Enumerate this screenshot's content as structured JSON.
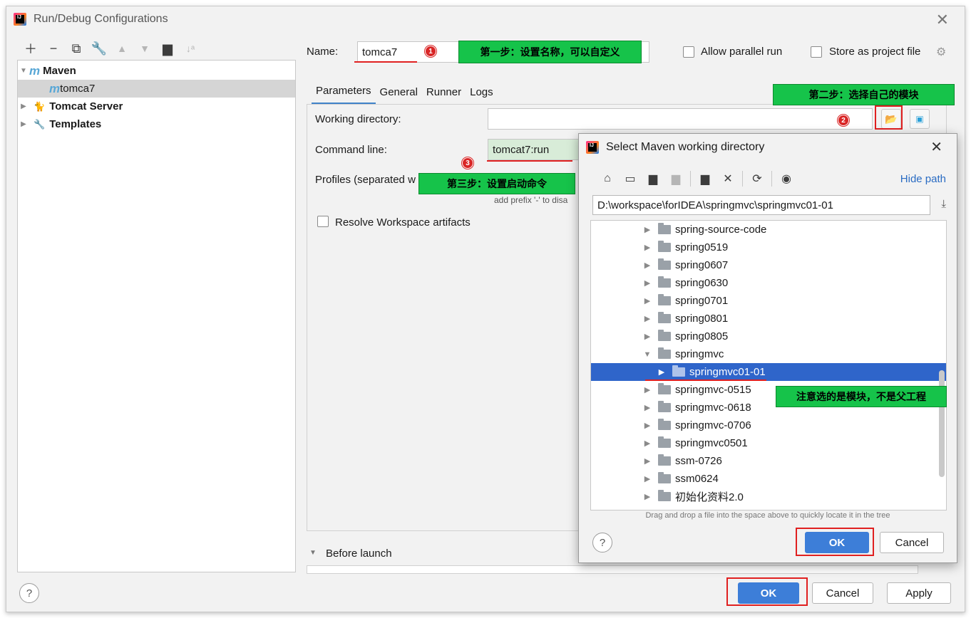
{
  "window": {
    "title": "Run/Debug Configurations"
  },
  "tree": {
    "maven_label": "Maven",
    "maven_child": "tomca7",
    "tomcat_label": "Tomcat Server",
    "templates_label": "Templates"
  },
  "form": {
    "name_label": "Name:",
    "name_value": "tomca7",
    "allow_parallel_label": "Allow parallel run",
    "store_project_label": "Store as project file",
    "tabs": [
      "Parameters",
      "General",
      "Runner",
      "Logs"
    ],
    "working_dir_label": "Working directory:",
    "command_line_label": "Command line:",
    "command_line_value": "tomcat7:run",
    "profiles_label": "Profiles (separated w",
    "profiles_hint": "add prefix '-' to disa",
    "resolve_label": "Resolve Workspace artifacts",
    "before_launch_label": "Before launch"
  },
  "annotations": {
    "step1": "第一步：设置名称，可以自定义",
    "step2": "第二步：选择自己的模块",
    "step3": "第三步：设置启动命令",
    "note": "注意选的是模块，不是父工程",
    "badge1": "1",
    "badge2": "2",
    "badge3": "3"
  },
  "dialog": {
    "title": "Select Maven working directory",
    "hide_path": "Hide path",
    "path_value": "D:\\workspace\\forIDEA\\springmvc\\springmvc01-01",
    "folders": [
      "spring-source-code",
      "spring0519",
      "spring0607",
      "spring0630",
      "spring0701",
      "spring0801",
      "spring0805",
      "springmvc",
      "springmvc01-01",
      "springmvc-0515",
      "springmvc-0618",
      "springmvc-0706",
      "springmvc0501",
      "ssm-0726",
      "ssm0624",
      "初始化资料2.0"
    ],
    "hint": "Drag and drop a file into the space above to quickly locate it in the tree",
    "ok": "OK",
    "cancel": "Cancel"
  },
  "footer": {
    "ok": "OK",
    "cancel": "Cancel",
    "apply": "Apply",
    "help": "?"
  }
}
